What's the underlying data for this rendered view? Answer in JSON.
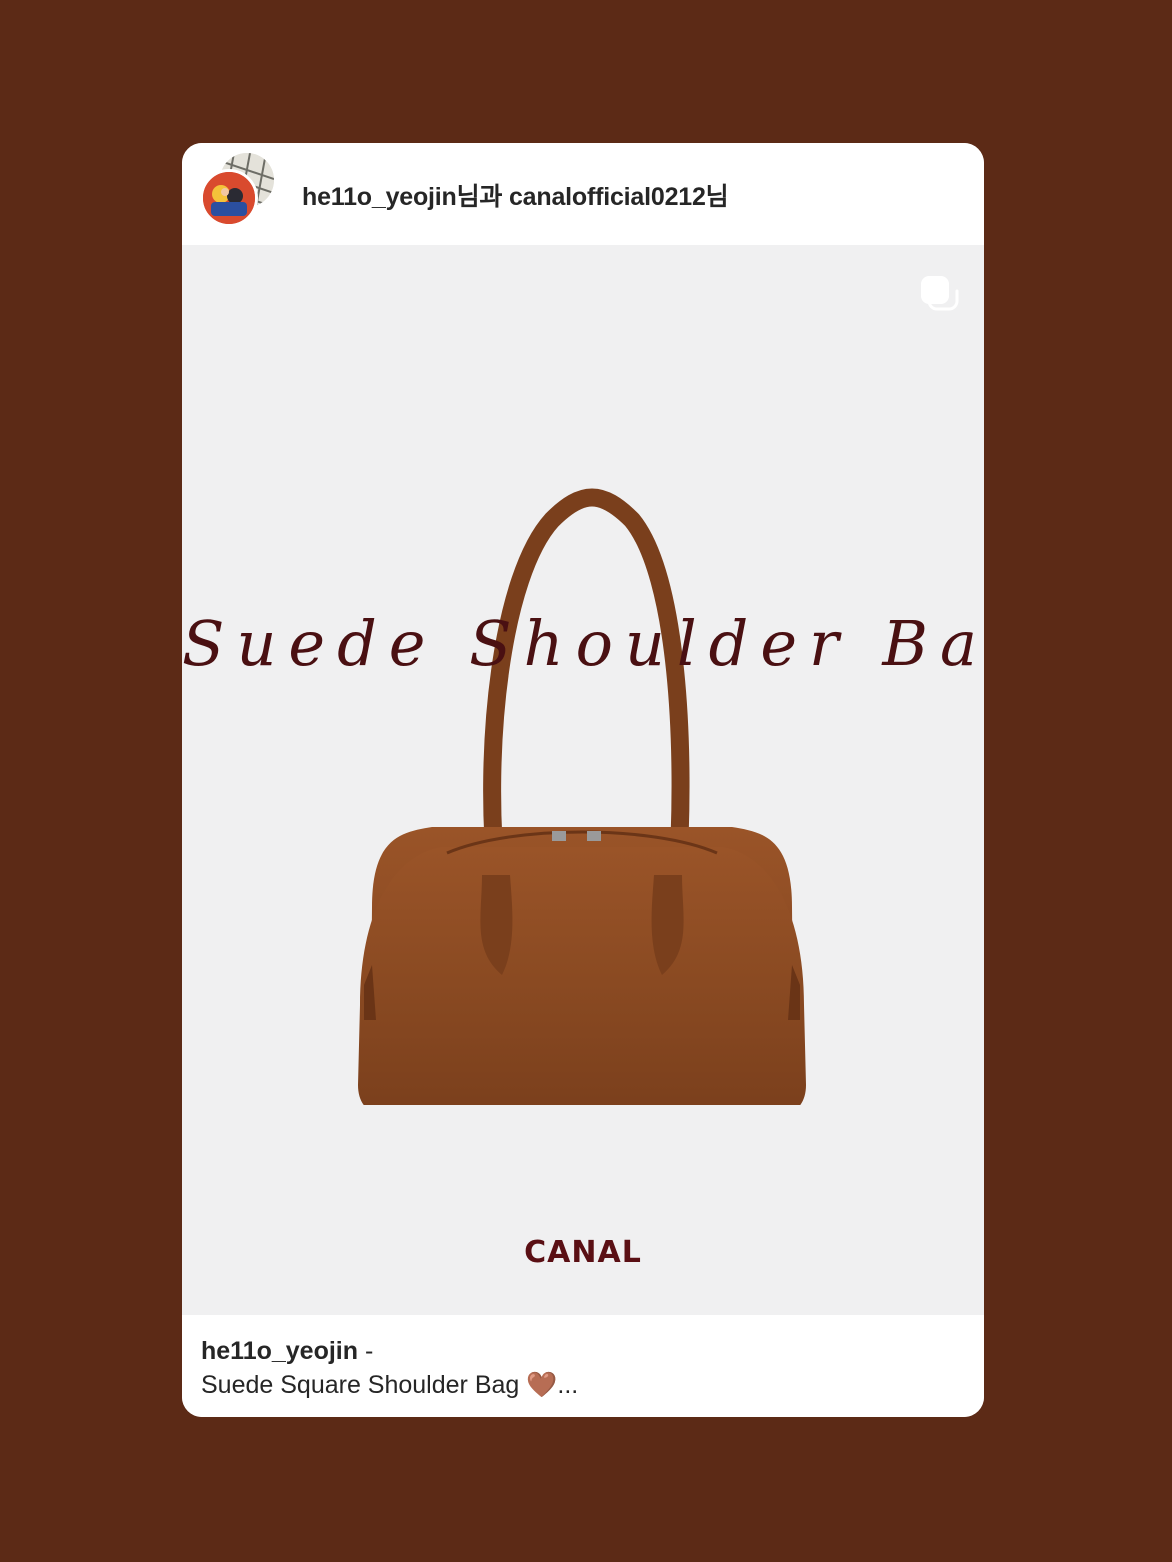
{
  "header": {
    "users_text": "he11o_yeojin님과 canalofficial0212님"
  },
  "media": {
    "title_script": "Suede Shoulder Bag",
    "brand": "CANAL",
    "multi_icon": "carousel-icon",
    "bag_color": "#8a4a22"
  },
  "footer": {
    "username": "he11o_yeojin",
    "dash": " -",
    "caption": "Suede Square Shoulder Bag 🤎..."
  },
  "colors": {
    "background": "#5c2a16",
    "card": "#ffffff",
    "media_bg": "#f0f0f1",
    "script_text": "#4a1012"
  }
}
